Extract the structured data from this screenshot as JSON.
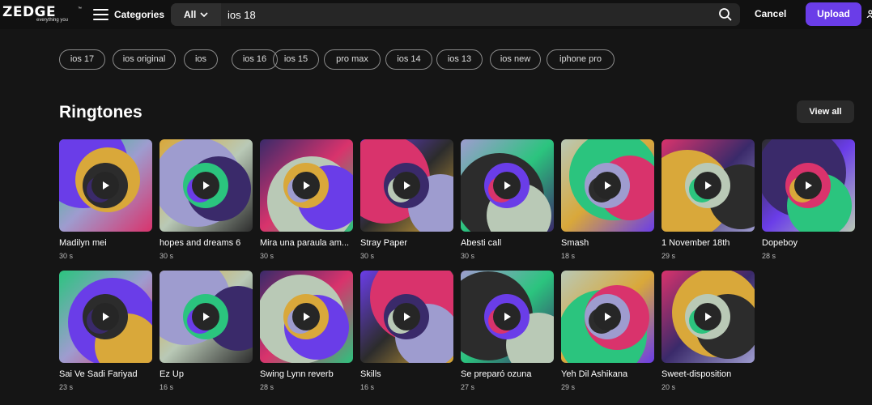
{
  "header": {
    "logo_text": "ZEDGE",
    "logo_tm": "™",
    "logo_tagline": "everything you",
    "menu_label": "Categories",
    "filter_label": "All",
    "search_value": "ios 18",
    "cancel_label": "Cancel",
    "upload_label": "Upload"
  },
  "tags": [
    "ios 17",
    "ios original",
    "ios",
    "ios 16",
    "ios 15",
    "pro max",
    "ios 14",
    "ios 13",
    "ios new",
    "iphone pro"
  ],
  "section": {
    "title": "Ringtones",
    "view_all": "View all"
  },
  "ringtones": [
    {
      "title": "Madilyn mei",
      "duration": "30 s"
    },
    {
      "title": "hopes and dreams 6",
      "duration": "30 s"
    },
    {
      "title": "Mira una paraula am...",
      "duration": "30 s"
    },
    {
      "title": "Stray Paper",
      "duration": "30 s"
    },
    {
      "title": "Abesti call",
      "duration": "30 s"
    },
    {
      "title": "Smash",
      "duration": "18 s"
    },
    {
      "title": "1 November 18th",
      "duration": "29 s"
    },
    {
      "title": "Dopeboy",
      "duration": "28 s"
    },
    {
      "title": "Sai Ve Sadi Fariyad",
      "duration": "23 s"
    },
    {
      "title": "Ez Up",
      "duration": "16 s"
    },
    {
      "title": "Swing Lynn reverb",
      "duration": "28 s"
    },
    {
      "title": "Skills",
      "duration": "16 s"
    },
    {
      "title": "Se preparó ozuna",
      "duration": "27 s"
    },
    {
      "title": "Yeh Dil Ashikana",
      "duration": "29 s"
    },
    {
      "title": "Sweet-disposition",
      "duration": "20 s"
    }
  ],
  "colors": {
    "accent": "#6a3de8",
    "background": "#151515",
    "palette": [
      "#2bc47e",
      "#6a3de8",
      "#d9336c",
      "#d9a83a",
      "#9e9ccf",
      "#2c2c2c",
      "#3a2a6a",
      "#b9c9b6"
    ]
  }
}
